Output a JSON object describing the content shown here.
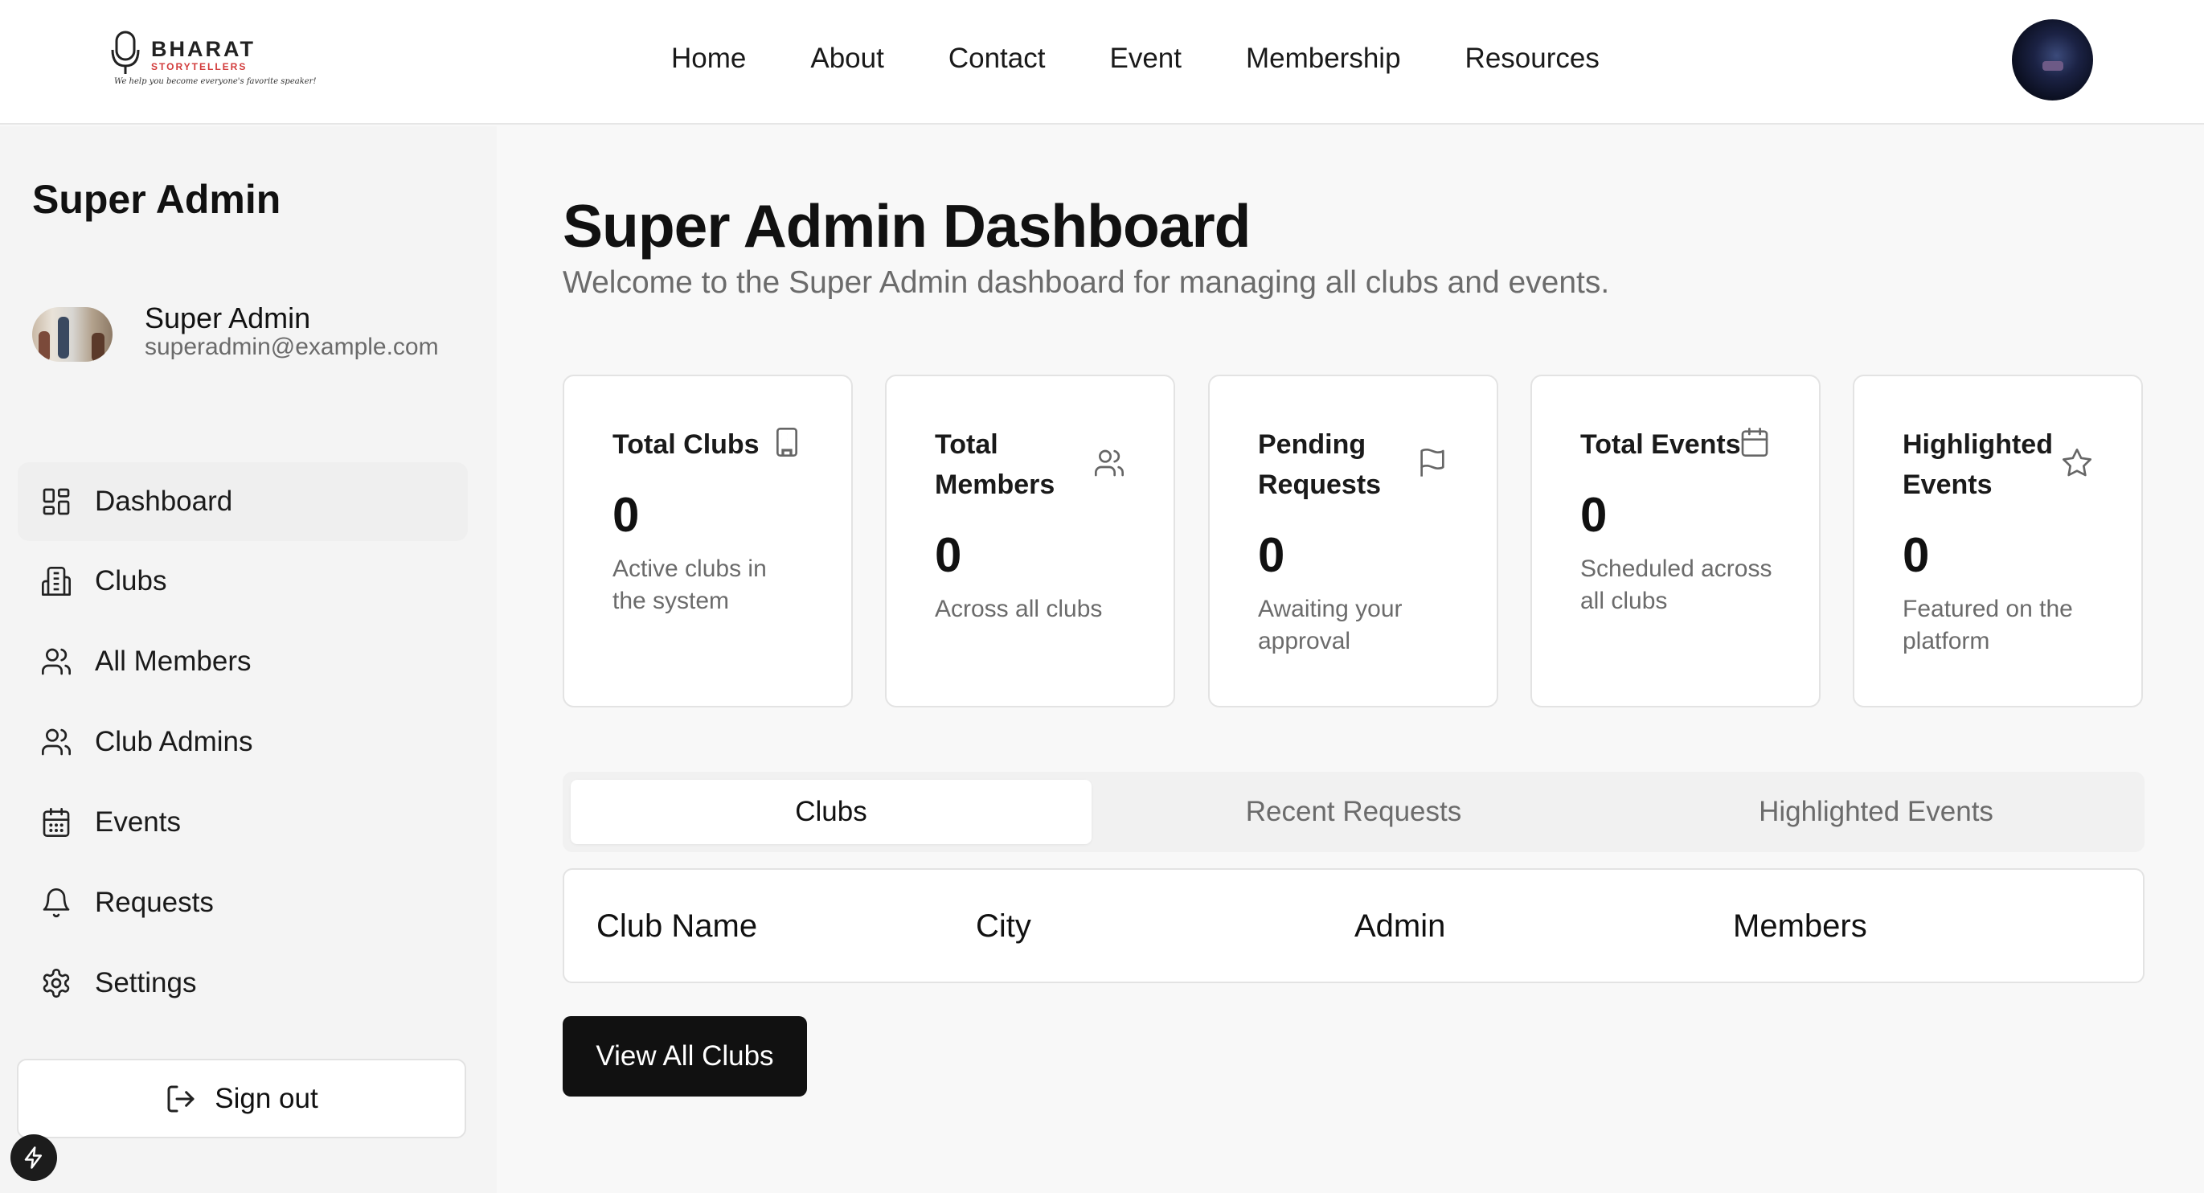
{
  "brand": {
    "name": "BHARAT",
    "sub": "STORYTELLERS",
    "tagline": "We help you become everyone's favorite speaker!"
  },
  "nav": {
    "items": [
      "Home",
      "About",
      "Contact",
      "Event",
      "Membership",
      "Resources"
    ]
  },
  "sidebar": {
    "title": "Super Admin",
    "profile": {
      "name": "Super Admin",
      "email": "superadmin@example.com"
    },
    "items": [
      {
        "label": "Dashboard",
        "icon": "dashboard-icon"
      },
      {
        "label": "Clubs",
        "icon": "building-icon"
      },
      {
        "label": "All Members",
        "icon": "users-icon"
      },
      {
        "label": "Club Admins",
        "icon": "users-icon"
      },
      {
        "label": "Events",
        "icon": "calendar-icon"
      },
      {
        "label": "Requests",
        "icon": "bell-icon"
      },
      {
        "label": "Settings",
        "icon": "gear-icon"
      }
    ],
    "signout": "Sign out"
  },
  "main": {
    "title": "Super Admin Dashboard",
    "subtitle": "Welcome to the Super Admin dashboard for managing all clubs and events.",
    "cards": [
      {
        "title": "Total Clubs",
        "value": "0",
        "desc": "Active clubs in the system",
        "icon": "building-icon"
      },
      {
        "title": "Total Members",
        "value": "0",
        "desc": "Across all clubs",
        "icon": "users-icon"
      },
      {
        "title": "Pending Requests",
        "value": "0",
        "desc": "Awaiting your approval",
        "icon": "flag-icon"
      },
      {
        "title": "Total Events",
        "value": "0",
        "desc": "Scheduled across all clubs",
        "icon": "calendar-icon"
      },
      {
        "title": "Highlighted Events",
        "value": "0",
        "desc": "Featured on the platform",
        "icon": "star-icon"
      }
    ],
    "tabs": [
      "Clubs",
      "Recent Requests",
      "Highlighted Events"
    ],
    "active_tab": "Clubs",
    "table": {
      "columns": [
        "Club Name",
        "City",
        "Admin",
        "Members"
      ]
    },
    "view_all": "View All Clubs"
  }
}
